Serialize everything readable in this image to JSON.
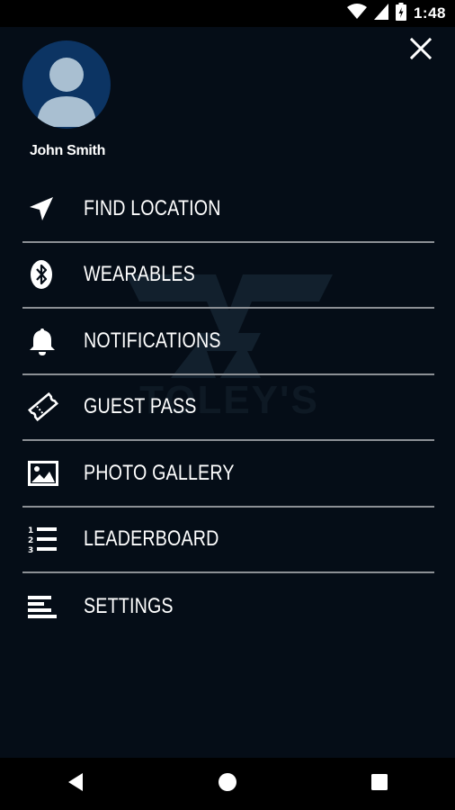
{
  "status_bar": {
    "time": "1:48",
    "icons": [
      "wifi-icon",
      "cell-signal-icon",
      "battery-icon"
    ]
  },
  "drawer": {
    "close_icon": "close-icon",
    "user": {
      "name": "John Smith",
      "avatar_icon": "person-icon"
    },
    "watermark": {
      "text": "TOLEY'S"
    },
    "menu": [
      {
        "label": "FIND LOCATION",
        "icon": "navigation-arrow-icon"
      },
      {
        "label": "WEARABLES",
        "icon": "bluetooth-icon"
      },
      {
        "label": "NOTIFICATIONS",
        "icon": "bell-icon"
      },
      {
        "label": "GUEST PASS",
        "icon": "ticket-icon"
      },
      {
        "label": "PHOTO GALLERY",
        "icon": "image-icon"
      },
      {
        "label": "LEADERBOARD",
        "icon": "numbered-list-icon"
      },
      {
        "label": "SETTINGS",
        "icon": "settings-lines-icon"
      }
    ]
  },
  "nav_bar": {
    "buttons": [
      "back-icon",
      "home-icon",
      "recents-icon"
    ]
  },
  "colors": {
    "background": "#050d17",
    "avatar_bg": "#0c3463",
    "avatar_figure": "#a9bfd1",
    "divider": "#8c9095",
    "text": "#ffffff"
  }
}
